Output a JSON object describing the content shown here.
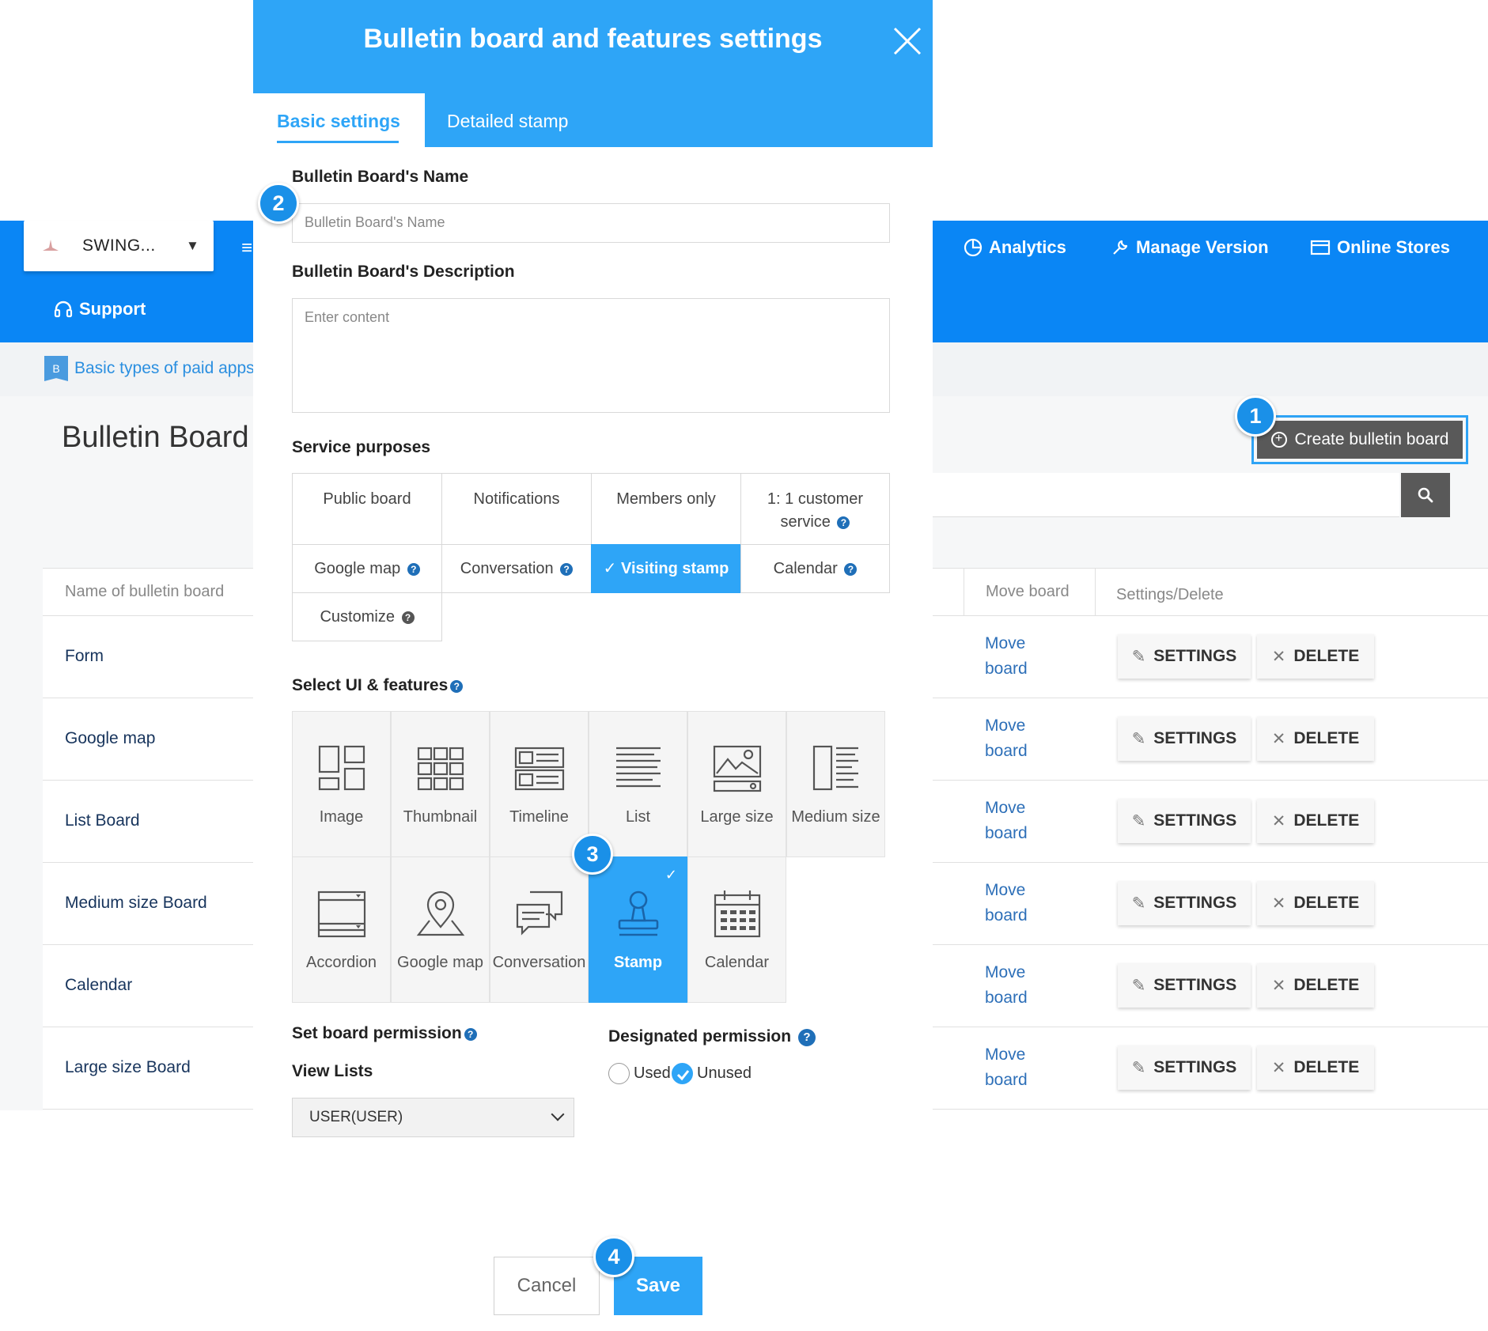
{
  "app": {
    "selected_app": "SWING...",
    "nav": {
      "support": "Support",
      "analytics": "Analytics",
      "manage_version": "Manage Version",
      "online_stores": "Online Stores"
    },
    "breadcrumb_icon": "B",
    "breadcrumb": "Basic types of paid apps",
    "page_title": "Bulletin Board",
    "create_button": "Create bulletin board",
    "table": {
      "headers": {
        "name": "Name of bulletin board",
        "move": "Move board",
        "settings": "Settings/Delete"
      },
      "rows": [
        {
          "name": "Form",
          "move_line1": "Move",
          "move_line2": "board"
        },
        {
          "name": "Google map",
          "move_line1": "Move",
          "move_line2": "board"
        },
        {
          "name": "List Board",
          "move_line1": "Move",
          "move_line2": "board"
        },
        {
          "name": "Medium size Board",
          "move_line1": "Move",
          "move_line2": "board"
        },
        {
          "name": "Calendar",
          "move_line1": "Move",
          "move_line2": "board"
        },
        {
          "name": "Large size Board",
          "move_line1": "Move",
          "move_line2": "board"
        }
      ],
      "settings_label": "SETTINGS",
      "delete_label": "DELETE"
    }
  },
  "modal": {
    "title": "Bulletin board and features settings",
    "tabs": {
      "basic": "Basic settings",
      "detailed": "Detailed stamp"
    },
    "name_label": "Bulletin Board's Name",
    "name_placeholder": "Bulletin Board's Name",
    "desc_label": "Bulletin Board's Description",
    "desc_placeholder": "Enter content",
    "service_label": "Service purposes",
    "services": {
      "public": "Public board",
      "notifications": "Notifications",
      "members": "Members only",
      "customer_line1": "1: 1 customer",
      "customer_line2": "service",
      "google_map": "Google map",
      "conversation": "Conversation",
      "visiting_stamp": "Visiting stamp",
      "calendar": "Calendar",
      "customize": "Customize"
    },
    "selected_service": "Visiting stamp",
    "features_label": "Select UI & features",
    "features": {
      "image": "Image",
      "thumbnail": "Thumbnail",
      "timeline": "Timeline",
      "list": "List",
      "large_size": "Large size",
      "medium_size": "Medium size",
      "accordion": "Accordion",
      "google_map": "Google map",
      "conversation": "Conversation",
      "stamp": "Stamp",
      "calendar": "Calendar"
    },
    "selected_feature": "Stamp",
    "permission_label": "Set board permission",
    "view_lists_label": "View Lists",
    "view_lists_value": "USER(USER)",
    "designated_label": "Designated permission",
    "radio_used": "Used",
    "radio_unused": "Unused",
    "designated_value": "Unused",
    "cancel": "Cancel",
    "save": "Save"
  },
  "markers": {
    "m1": "1",
    "m2": "2",
    "m3": "3",
    "m4": "4"
  },
  "colors": {
    "primary_blue": "#0a86f5",
    "modal_blue": "#2ea5f7",
    "dark_button": "#595959",
    "marker": "#1a90e8"
  }
}
